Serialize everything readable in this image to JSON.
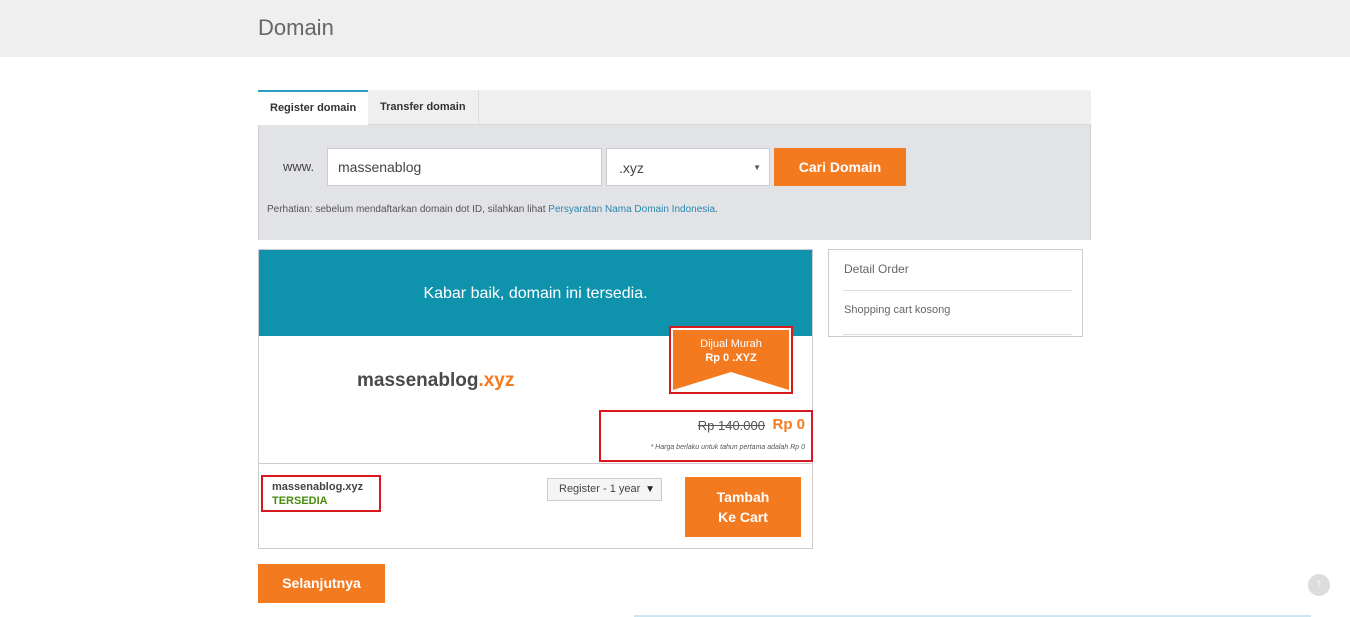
{
  "header": {
    "title": "Domain"
  },
  "tabs": [
    {
      "label": "Register domain",
      "active": true
    },
    {
      "label": "Transfer domain",
      "active": false
    }
  ],
  "search": {
    "prefix": "www.",
    "query": "massenablog",
    "tld": ".xyz",
    "button_label": "Cari Domain",
    "notice_text": "Perhatian: sebelum mendaftarkan domain dot ID, silahkan lihat ",
    "notice_link": "Persyaratan Nama Domain Indonesia",
    "notice_end": "."
  },
  "result": {
    "banner": "Kabar baik, domain ini tersedia.",
    "domain_base": "massenablog",
    "domain_ext": ".xyz",
    "promo_line1": "Dijual Murah",
    "promo_line2": "Rp 0 .XYZ",
    "old_price": "Rp 140.000",
    "new_price": "Rp 0",
    "price_note": "* Harga berlaku untuk tahun pertama adalah Rp 0",
    "status_domain": "massenablog.xyz",
    "status_label": "TERSEDIA",
    "period": "Register - 1 year",
    "add_cart_line1": "Tambah",
    "add_cart_line2": "Ke Cart"
  },
  "order": {
    "title": "Detail Order",
    "empty": "Shopping cart kosong"
  },
  "next_label": "Selanjutnya",
  "colors": {
    "accent": "#f47a20",
    "banner": "#0f93ad",
    "highlight": "#d8181e",
    "available": "#4a8a0e"
  },
  "icons": {
    "scroll_top": "arrow-up-icon",
    "dropdown": "caret-down-icon"
  }
}
